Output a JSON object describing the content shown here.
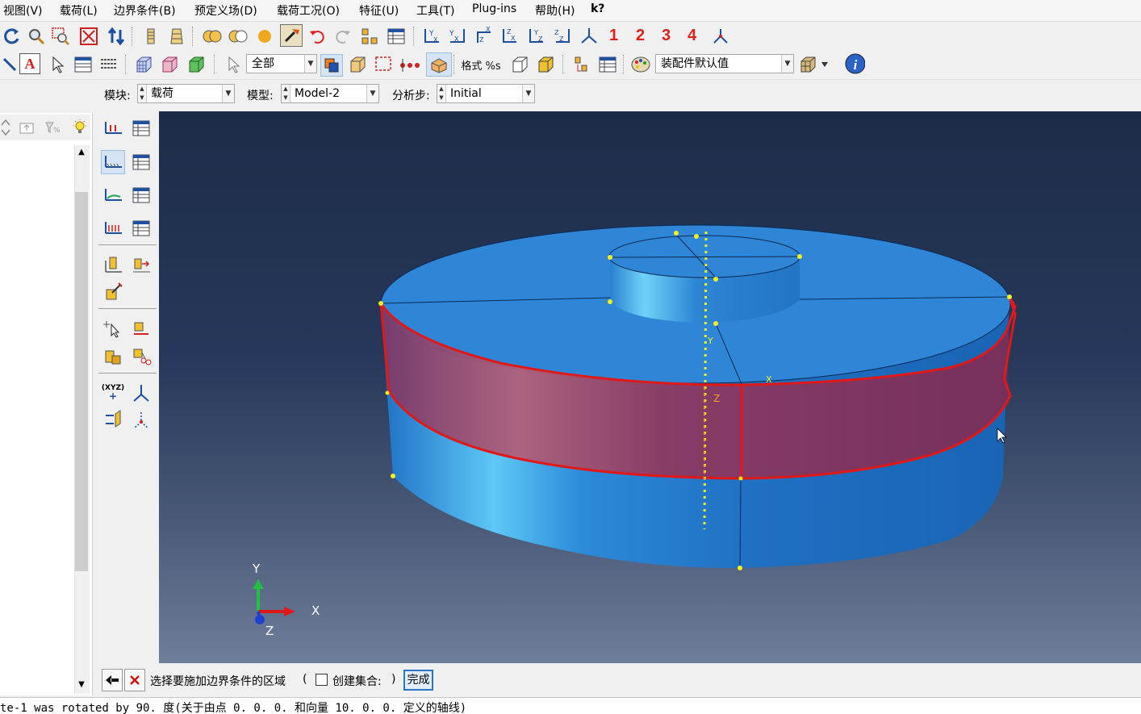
{
  "menu": [
    "视图(V)",
    "载荷(L)",
    "边界条件(B)",
    "预定义场(D)",
    "载荷工况(O)",
    "特征(U)",
    "工具(T)",
    "Plug-ins",
    "帮助(H)",
    "k?"
  ],
  "toolbar": {
    "views": [
      "1",
      "2",
      "3",
      "4"
    ],
    "selection_filter": "全部",
    "render_label": "格式 %s",
    "assembly_color": "装配件默认值"
  },
  "context": {
    "module_label": "模块:",
    "module_value": "载荷",
    "model_label": "模型:",
    "model_value": "Model-2",
    "step_label": "分析步:",
    "step_value": "Initial"
  },
  "tools": {
    "triad_label": "(XYZ)"
  },
  "viewport": {
    "part_color": "#2f86d6",
    "selection_color": "#e01818",
    "axis_labels": {
      "y": "Y",
      "x": "X",
      "z": "Z"
    },
    "datum_labels": {
      "y": "Y",
      "x": "X",
      "z": "Z"
    }
  },
  "prompt": {
    "text": "选择要施加边界条件的区域",
    "open_paren": "(",
    "checkbox_label": "创建集合:",
    "close_paren": ")",
    "done_label": "完成",
    "create_set_checked": false
  },
  "command_line": "te-1 was rotated by 90. 度(关于由点 0.     0.     0.   和向量 10.     0.     0.   定义的轴线)"
}
